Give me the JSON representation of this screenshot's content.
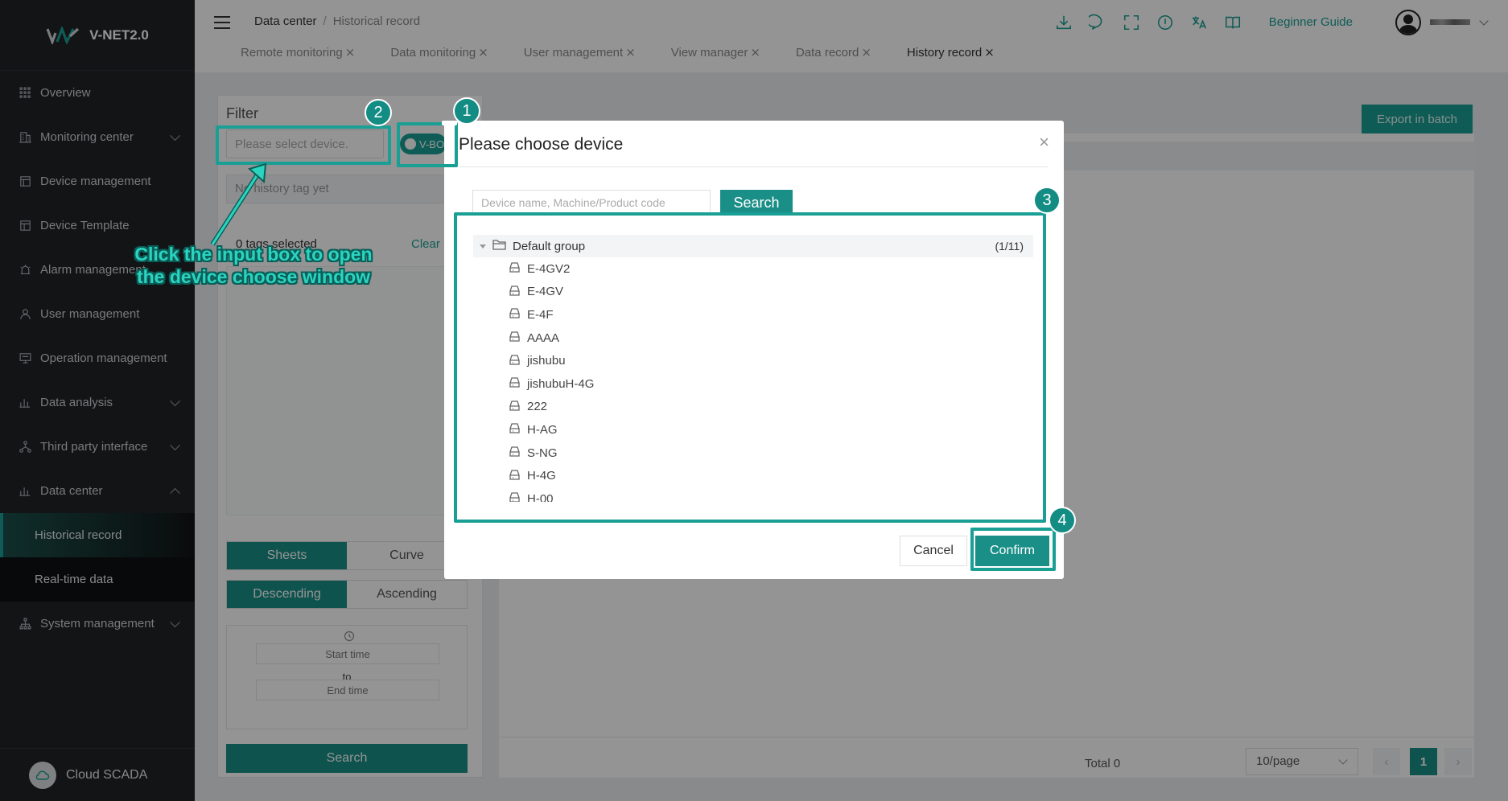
{
  "app": {
    "name": "V-NET2.0",
    "footer_label": "Cloud SCADA"
  },
  "sidebar": {
    "items": [
      {
        "label": "Overview",
        "icon": "grid-icon"
      },
      {
        "label": "Monitoring center",
        "icon": "building-icon",
        "expandable": true
      },
      {
        "label": "Device management",
        "icon": "list-icon"
      },
      {
        "label": "Device Template",
        "icon": "template-icon"
      },
      {
        "label": "Alarm management",
        "icon": "alarm-icon"
      },
      {
        "label": "User management",
        "icon": "user-icon"
      },
      {
        "label": "Operation management",
        "icon": "monitor-icon"
      },
      {
        "label": "Data analysis",
        "icon": "bar-chart-icon",
        "expandable": true
      },
      {
        "label": "Third party interface",
        "icon": "network-icon",
        "expandable": true
      },
      {
        "label": "Data center",
        "icon": "bar-chart-icon",
        "expandable": true,
        "expanded": true
      },
      {
        "label": "System management",
        "icon": "org-icon",
        "expandable": true
      }
    ],
    "submenu": [
      {
        "label": "Historical record",
        "active": true
      },
      {
        "label": "Real-time data",
        "active": false
      }
    ]
  },
  "header": {
    "breadcrumb": {
      "home": "Data center",
      "separator": "/",
      "current": "Historical record"
    },
    "beginner_guide": "Beginner Guide",
    "icons": [
      "download-icon",
      "message-icon",
      "fullscreen-icon",
      "info-icon",
      "translate-icon",
      "help-book-icon"
    ],
    "tabs": [
      {
        "label": "Remote monitoring",
        "active": false
      },
      {
        "label": "Data monitoring",
        "active": false
      },
      {
        "label": "User management",
        "active": false
      },
      {
        "label": "View manager",
        "active": false
      },
      {
        "label": "Data record",
        "active": false
      },
      {
        "label": "History record",
        "active": true
      }
    ],
    "tab_close": "⨯"
  },
  "filter": {
    "title": "Filter",
    "device_placeholder": "Please select device.",
    "toggle_label": "V-BO",
    "tag_placeholder": "No history tag yet",
    "tags_selected": "0 tags selected",
    "clear": "Clear",
    "view_modes": [
      "Sheets",
      "Curve"
    ],
    "active_view_mode": "Sheets",
    "orders": [
      "Descending",
      "Ascending"
    ],
    "active_order": "Descending",
    "start_time": "Start time",
    "to": "to",
    "end_time": "End time",
    "search": "Search"
  },
  "content": {
    "export_button": "Export in batch",
    "total": "Total 0",
    "page_size": "10/page",
    "current_page": "1"
  },
  "modal": {
    "title": "Please choose device",
    "search_placeholder": "Device name, Machine/Product code",
    "search_button": "Search",
    "group": {
      "name": "Default group",
      "count": "(1/11)"
    },
    "devices": [
      "E-4GV2",
      "E-4GV",
      "E-4F",
      "AAAA",
      "jishubu",
      "jishubuH-4G",
      "222",
      "H-AG",
      "S-NG",
      "H-4G",
      "H-00"
    ],
    "cancel": "Cancel",
    "confirm": "Confirm"
  },
  "annotations": {
    "steps": [
      "1",
      "2",
      "3",
      "4"
    ],
    "callout": "Click the input box to open the device choose window",
    "accent": "#1a9f95"
  }
}
